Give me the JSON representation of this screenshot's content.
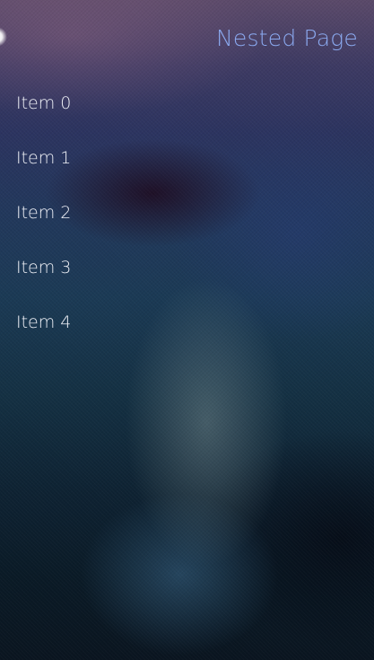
{
  "page": {
    "title": "Nested Page"
  },
  "list": {
    "items": [
      {
        "label": "Item 0"
      },
      {
        "label": "Item 1"
      },
      {
        "label": "Item 2"
      },
      {
        "label": "Item 3"
      },
      {
        "label": "Item 4"
      }
    ]
  },
  "colors": {
    "title": "#8aa8ee",
    "item_text": "#eef0f6"
  }
}
